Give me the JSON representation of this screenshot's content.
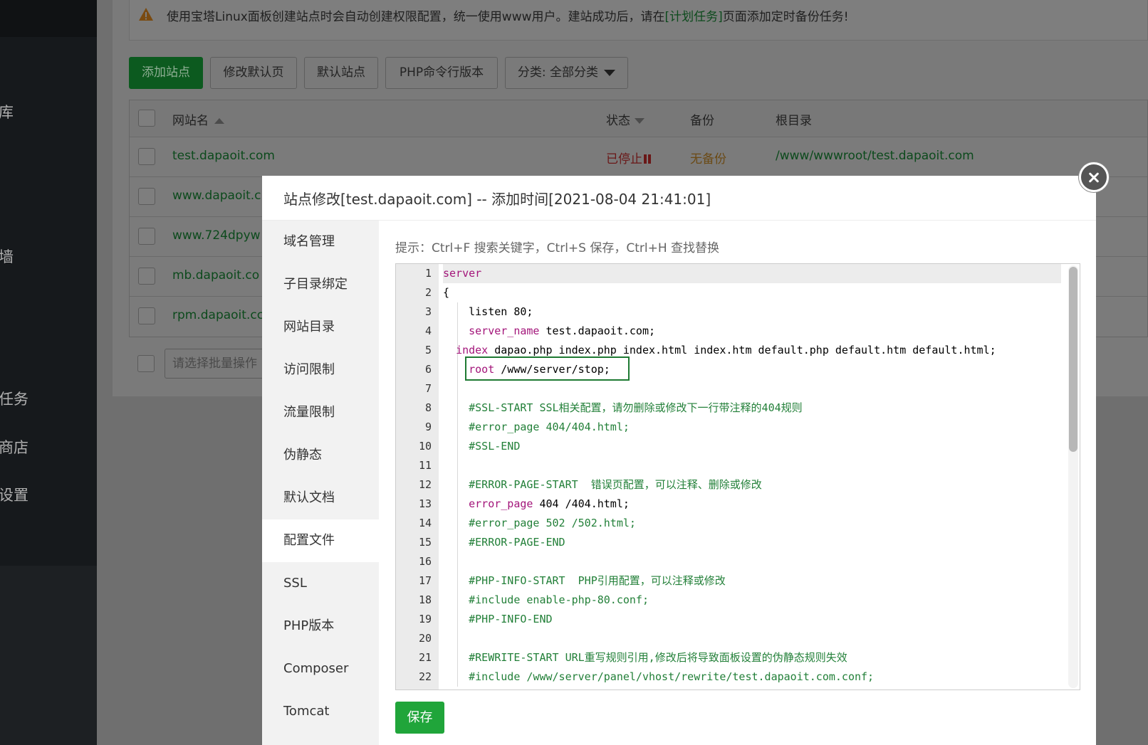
{
  "sidebar": {
    "items": [
      {
        "label": "库"
      },
      {
        "label": "墙"
      },
      {
        "label": "任务"
      },
      {
        "label": "商店"
      },
      {
        "label": "设置"
      }
    ]
  },
  "notice": {
    "text_before": "使用宝塔Linux面板创建站点时会自动创建权限配置，统一使用www用户。建站成功后，请在",
    "link": "[计划任务]",
    "text_after": "页面添加定时备份任务!"
  },
  "toolbar": {
    "add_site": "添加站点",
    "edit_default_page": "修改默认页",
    "default_site": "默认站点",
    "php_cli_version": "PHP命令行版本",
    "category": "分类: 全部分类"
  },
  "table": {
    "headers": {
      "name": "网站名",
      "status": "状态",
      "backup": "备份",
      "root": "根目录"
    },
    "rows": [
      {
        "name": "test.dapaoit.com",
        "status": "已停止",
        "backup": "无备份",
        "root": "/www/wwwroot/test.dapaoit.com"
      },
      {
        "name": "www.dapaoit.c",
        "status": "",
        "backup": "",
        "root": ""
      },
      {
        "name": "www.724dpyw",
        "status": "",
        "backup": "",
        "root": ""
      },
      {
        "name": "mb.dapaoit.co",
        "status": "",
        "backup": "",
        "root": ""
      },
      {
        "name": "rpm.dapaoit.cc",
        "status": "",
        "backup": "",
        "root": ""
      }
    ],
    "batch_placeholder": "请选择批量操作"
  },
  "modal": {
    "title": "站点修改[test.dapaoit.com] -- 添加时间[2021-08-04 21:41:01]",
    "nav": [
      {
        "label": "域名管理"
      },
      {
        "label": "子目录绑定"
      },
      {
        "label": "网站目录"
      },
      {
        "label": "访问限制"
      },
      {
        "label": "流量限制"
      },
      {
        "label": "伪静态"
      },
      {
        "label": "默认文档"
      },
      {
        "label": "配置文件"
      },
      {
        "label": "SSL"
      },
      {
        "label": "PHP版本"
      },
      {
        "label": "Composer"
      },
      {
        "label": "Tomcat"
      }
    ],
    "active_nav": "配置文件",
    "hint": "提示：Ctrl+F 搜索关键字，Ctrl+S 保存，Ctrl+H 查找替换",
    "save_label": "保存"
  },
  "editor": {
    "lines": [
      {
        "n": "1",
        "parts": [
          {
            "t": "server",
            "c": "kw"
          }
        ]
      },
      {
        "n": "2",
        "parts": [
          {
            "t": "{",
            "c": ""
          }
        ]
      },
      {
        "n": "3",
        "parts": [
          {
            "t": "    listen 80;",
            "c": ""
          }
        ]
      },
      {
        "n": "4",
        "parts": [
          {
            "t": "    ",
            "c": ""
          },
          {
            "t": "server_name",
            "c": "kw"
          },
          {
            "t": " test.dapaoit.com;",
            "c": ""
          }
        ]
      },
      {
        "n": "5",
        "parts": [
          {
            "t": "  ",
            "c": ""
          },
          {
            "t": "index",
            "c": "kw"
          },
          {
            "t": " dapao.php index.php index.html index.htm default.php default.htm default.html;",
            "c": ""
          }
        ]
      },
      {
        "n": "6",
        "parts": [
          {
            "t": "    ",
            "c": ""
          },
          {
            "t": "root",
            "c": "kw"
          },
          {
            "t": " /www/server/stop;",
            "c": ""
          }
        ]
      },
      {
        "n": "7",
        "parts": [
          {
            "t": "",
            "c": ""
          }
        ]
      },
      {
        "n": "8",
        "parts": [
          {
            "t": "    #SSL-START SSL相关配置，请勿删除或修改下一行带注释的404规则",
            "c": "cm"
          }
        ]
      },
      {
        "n": "9",
        "parts": [
          {
            "t": "    #error_page 404/404.html;",
            "c": "cm"
          }
        ]
      },
      {
        "n": "10",
        "parts": [
          {
            "t": "    #SSL-END",
            "c": "cm"
          }
        ]
      },
      {
        "n": "11",
        "parts": [
          {
            "t": "",
            "c": ""
          }
        ]
      },
      {
        "n": "12",
        "parts": [
          {
            "t": "    #ERROR-PAGE-START  错误页配置，可以注释、删除或修改",
            "c": "cm"
          }
        ]
      },
      {
        "n": "13",
        "parts": [
          {
            "t": "    ",
            "c": ""
          },
          {
            "t": "error_page",
            "c": "kw"
          },
          {
            "t": " 404 /404.html;",
            "c": ""
          }
        ]
      },
      {
        "n": "14",
        "parts": [
          {
            "t": "    #error_page 502 /502.html;",
            "c": "cm"
          }
        ]
      },
      {
        "n": "15",
        "parts": [
          {
            "t": "    #ERROR-PAGE-END",
            "c": "cm"
          }
        ]
      },
      {
        "n": "16",
        "parts": [
          {
            "t": "",
            "c": ""
          }
        ]
      },
      {
        "n": "17",
        "parts": [
          {
            "t": "    #PHP-INFO-START  PHP引用配置，可以注释或修改",
            "c": "cm"
          }
        ]
      },
      {
        "n": "18",
        "parts": [
          {
            "t": "    #include enable-php-80.conf;",
            "c": "cm"
          }
        ]
      },
      {
        "n": "19",
        "parts": [
          {
            "t": "    #PHP-INFO-END",
            "c": "cm"
          }
        ]
      },
      {
        "n": "20",
        "parts": [
          {
            "t": "",
            "c": ""
          }
        ]
      },
      {
        "n": "21",
        "parts": [
          {
            "t": "    #REWRITE-START URL重写规则引用,修改后将导致面板设置的伪静态规则失效",
            "c": "cm"
          }
        ]
      },
      {
        "n": "22",
        "parts": [
          {
            "t": "    #include /www/server/panel/vhost/rewrite/test.dapaoit.com.conf;",
            "c": "cm"
          }
        ]
      }
    ]
  },
  "colors": {
    "primary_green": "#20a53a",
    "link_green": "#0c4a1c",
    "keyword": "#a3157a",
    "comment": "#238039"
  }
}
